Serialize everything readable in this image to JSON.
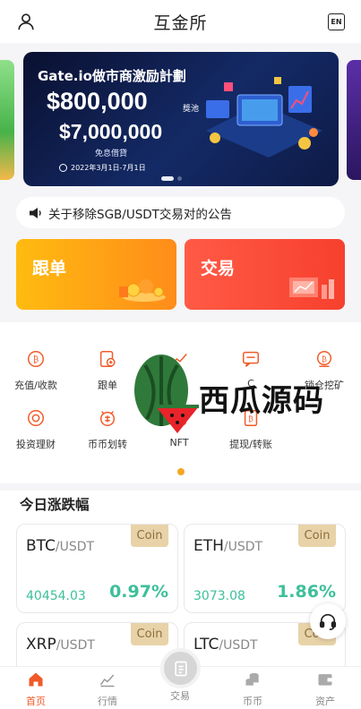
{
  "header": {
    "title": "互金所",
    "lang_badge": "EN"
  },
  "banner": {
    "title": "Gate.io做市商激励計劃",
    "amount_1": "$800,000",
    "amount_1_sub": "獎池",
    "amount_2": "$7,000,000",
    "amount_2_sub": "免息借貸",
    "date_range": "2022年3月1日-7月1日"
  },
  "announcement": {
    "text": "关于移除SGB/USDT交易对的公告"
  },
  "cards": {
    "follow": "跟单",
    "trade": "交易"
  },
  "grid": [
    {
      "label": "充值/收款",
      "icon": "deposit-icon"
    },
    {
      "label": "跟单",
      "icon": "follow-icon"
    },
    {
      "label": "易",
      "icon": "chart-icon"
    },
    {
      "label": "C",
      "icon": "chat-icon"
    },
    {
      "label": "锁仓挖矿",
      "icon": "mining-icon"
    },
    {
      "label": "投资理财",
      "icon": "invest-icon"
    },
    {
      "label": "币币划转",
      "icon": "transfer-icon"
    },
    {
      "label": "NFT",
      "icon": "nft-icon"
    },
    {
      "label": "提现/转账",
      "icon": "withdraw-icon"
    }
  ],
  "watermark": {
    "text": "西瓜源码"
  },
  "today": {
    "title": "今日涨跌幅",
    "coins": [
      {
        "base": "BTC",
        "quote": "/USDT",
        "tag": "Coin",
        "price": "40454.03",
        "change": "0.97%"
      },
      {
        "base": "ETH",
        "quote": "/USDT",
        "tag": "Coin",
        "price": "3073.08",
        "change": "1.86%"
      },
      {
        "base": "XRP",
        "quote": "/USDT",
        "tag": "Coin",
        "price": "",
        "change": ""
      },
      {
        "base": "LTC",
        "quote": "/USDT",
        "tag": "Coin",
        "price": "",
        "change": ""
      }
    ]
  },
  "nav": {
    "home": "首页",
    "market": "行情",
    "trade": "交易",
    "coin": "币币",
    "assets": "资产"
  },
  "colors": {
    "accent": "#f05a28",
    "up": "#3dbf9a",
    "tag_bg": "#e8d3a8"
  }
}
